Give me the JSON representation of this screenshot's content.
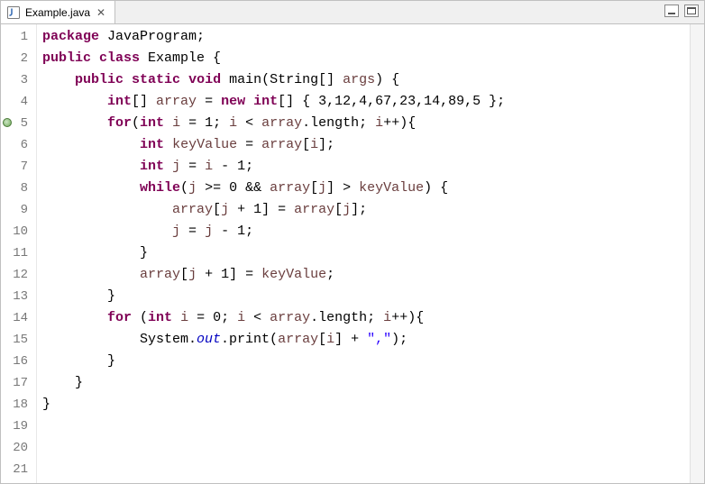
{
  "tab": {
    "filename": "Example.java",
    "close_glyph": "✕"
  },
  "code_lines": [
    {
      "n": 1,
      "tokens": [
        [
          "kw",
          "package"
        ],
        [
          "",
          " JavaProgram;"
        ]
      ]
    },
    {
      "n": 2,
      "tokens": [
        [
          "",
          ""
        ]
      ]
    },
    {
      "n": 3,
      "tokens": [
        [
          "kw",
          "public"
        ],
        [
          "",
          " "
        ],
        [
          "kw",
          "class"
        ],
        [
          "",
          " Example {"
        ]
      ]
    },
    {
      "n": 4,
      "tokens": [
        [
          "",
          ""
        ]
      ]
    },
    {
      "n": 5,
      "marker": "override",
      "tokens": [
        [
          "",
          "    "
        ],
        [
          "kw",
          "public"
        ],
        [
          "",
          " "
        ],
        [
          "kw",
          "static"
        ],
        [
          "",
          " "
        ],
        [
          "kw",
          "void"
        ],
        [
          "",
          " main(String[] "
        ],
        [
          "var",
          "args"
        ],
        [
          "",
          ") {"
        ]
      ]
    },
    {
      "n": 6,
      "tokens": [
        [
          "",
          "        "
        ],
        [
          "kw",
          "int"
        ],
        [
          "",
          "[] "
        ],
        [
          "var",
          "array"
        ],
        [
          "",
          " = "
        ],
        [
          "kw",
          "new"
        ],
        [
          "",
          " "
        ],
        [
          "kw",
          "int"
        ],
        [
          "",
          "[] { 3,12,4,67,23,14,89,5 };"
        ]
      ]
    },
    {
      "n": 7,
      "tokens": [
        [
          "",
          "        "
        ],
        [
          "kw",
          "for"
        ],
        [
          "",
          "("
        ],
        [
          "kw",
          "int"
        ],
        [
          "",
          " "
        ],
        [
          "var",
          "i"
        ],
        [
          "",
          " = 1; "
        ],
        [
          "var",
          "i"
        ],
        [
          "",
          " < "
        ],
        [
          "var",
          "array"
        ],
        [
          "",
          ".length; "
        ],
        [
          "var",
          "i"
        ],
        [
          "",
          "++){"
        ]
      ]
    },
    {
      "n": 8,
      "tokens": [
        [
          "",
          "            "
        ],
        [
          "kw",
          "int"
        ],
        [
          "",
          " "
        ],
        [
          "var",
          "keyValue"
        ],
        [
          "",
          " = "
        ],
        [
          "var",
          "array"
        ],
        [
          "",
          "["
        ],
        [
          "var",
          "i"
        ],
        [
          "",
          "];"
        ]
      ]
    },
    {
      "n": 9,
      "tokens": [
        [
          "",
          "            "
        ],
        [
          "kw",
          "int"
        ],
        [
          "",
          " "
        ],
        [
          "var",
          "j"
        ],
        [
          "",
          " = "
        ],
        [
          "var",
          "i"
        ],
        [
          "",
          " - 1;"
        ]
      ]
    },
    {
      "n": 10,
      "tokens": [
        [
          "",
          "            "
        ],
        [
          "kw",
          "while"
        ],
        [
          "",
          "("
        ],
        [
          "var",
          "j"
        ],
        [
          "",
          " >= 0 && "
        ],
        [
          "var",
          "array"
        ],
        [
          "",
          "["
        ],
        [
          "var",
          "j"
        ],
        [
          "",
          "] > "
        ],
        [
          "var",
          "keyValue"
        ],
        [
          "",
          ") {"
        ]
      ]
    },
    {
      "n": 11,
      "tokens": [
        [
          "",
          "                "
        ],
        [
          "var",
          "array"
        ],
        [
          "",
          "["
        ],
        [
          "var",
          "j"
        ],
        [
          "",
          " + 1] = "
        ],
        [
          "var",
          "array"
        ],
        [
          "",
          "["
        ],
        [
          "var",
          "j"
        ],
        [
          "",
          "];"
        ]
      ]
    },
    {
      "n": 12,
      "tokens": [
        [
          "",
          "                "
        ],
        [
          "var",
          "j"
        ],
        [
          "",
          " = "
        ],
        [
          "var",
          "j"
        ],
        [
          "",
          " - 1;"
        ]
      ]
    },
    {
      "n": 13,
      "tokens": [
        [
          "",
          "            }"
        ]
      ]
    },
    {
      "n": 14,
      "tokens": [
        [
          "",
          "            "
        ],
        [
          "var",
          "array"
        ],
        [
          "",
          "["
        ],
        [
          "var",
          "j"
        ],
        [
          "",
          " + 1] = "
        ],
        [
          "var",
          "keyValue"
        ],
        [
          "",
          ";"
        ]
      ]
    },
    {
      "n": 15,
      "tokens": [
        [
          "",
          "        }"
        ]
      ]
    },
    {
      "n": 16,
      "tokens": [
        [
          "",
          ""
        ]
      ]
    },
    {
      "n": 17,
      "tokens": [
        [
          "",
          "        "
        ],
        [
          "kw",
          "for"
        ],
        [
          "",
          " ("
        ],
        [
          "kw",
          "int"
        ],
        [
          "",
          " "
        ],
        [
          "var",
          "i"
        ],
        [
          "",
          " = 0; "
        ],
        [
          "var",
          "i"
        ],
        [
          "",
          " < "
        ],
        [
          "var",
          "array"
        ],
        [
          "",
          ".length; "
        ],
        [
          "var",
          "i"
        ],
        [
          "",
          "++){"
        ]
      ]
    },
    {
      "n": 18,
      "tokens": [
        [
          "",
          "            System."
        ],
        [
          "field",
          "out"
        ],
        [
          "",
          ".print("
        ],
        [
          "var",
          "array"
        ],
        [
          "",
          "["
        ],
        [
          "var",
          "i"
        ],
        [
          "",
          "] + "
        ],
        [
          "str",
          "\",\""
        ],
        [
          "",
          ");"
        ]
      ]
    },
    {
      "n": 19,
      "tokens": [
        [
          "",
          "        }"
        ]
      ]
    },
    {
      "n": 20,
      "tokens": [
        [
          "",
          "    }"
        ]
      ]
    },
    {
      "n": 21,
      "tokens": [
        [
          "",
          "}"
        ]
      ]
    }
  ]
}
